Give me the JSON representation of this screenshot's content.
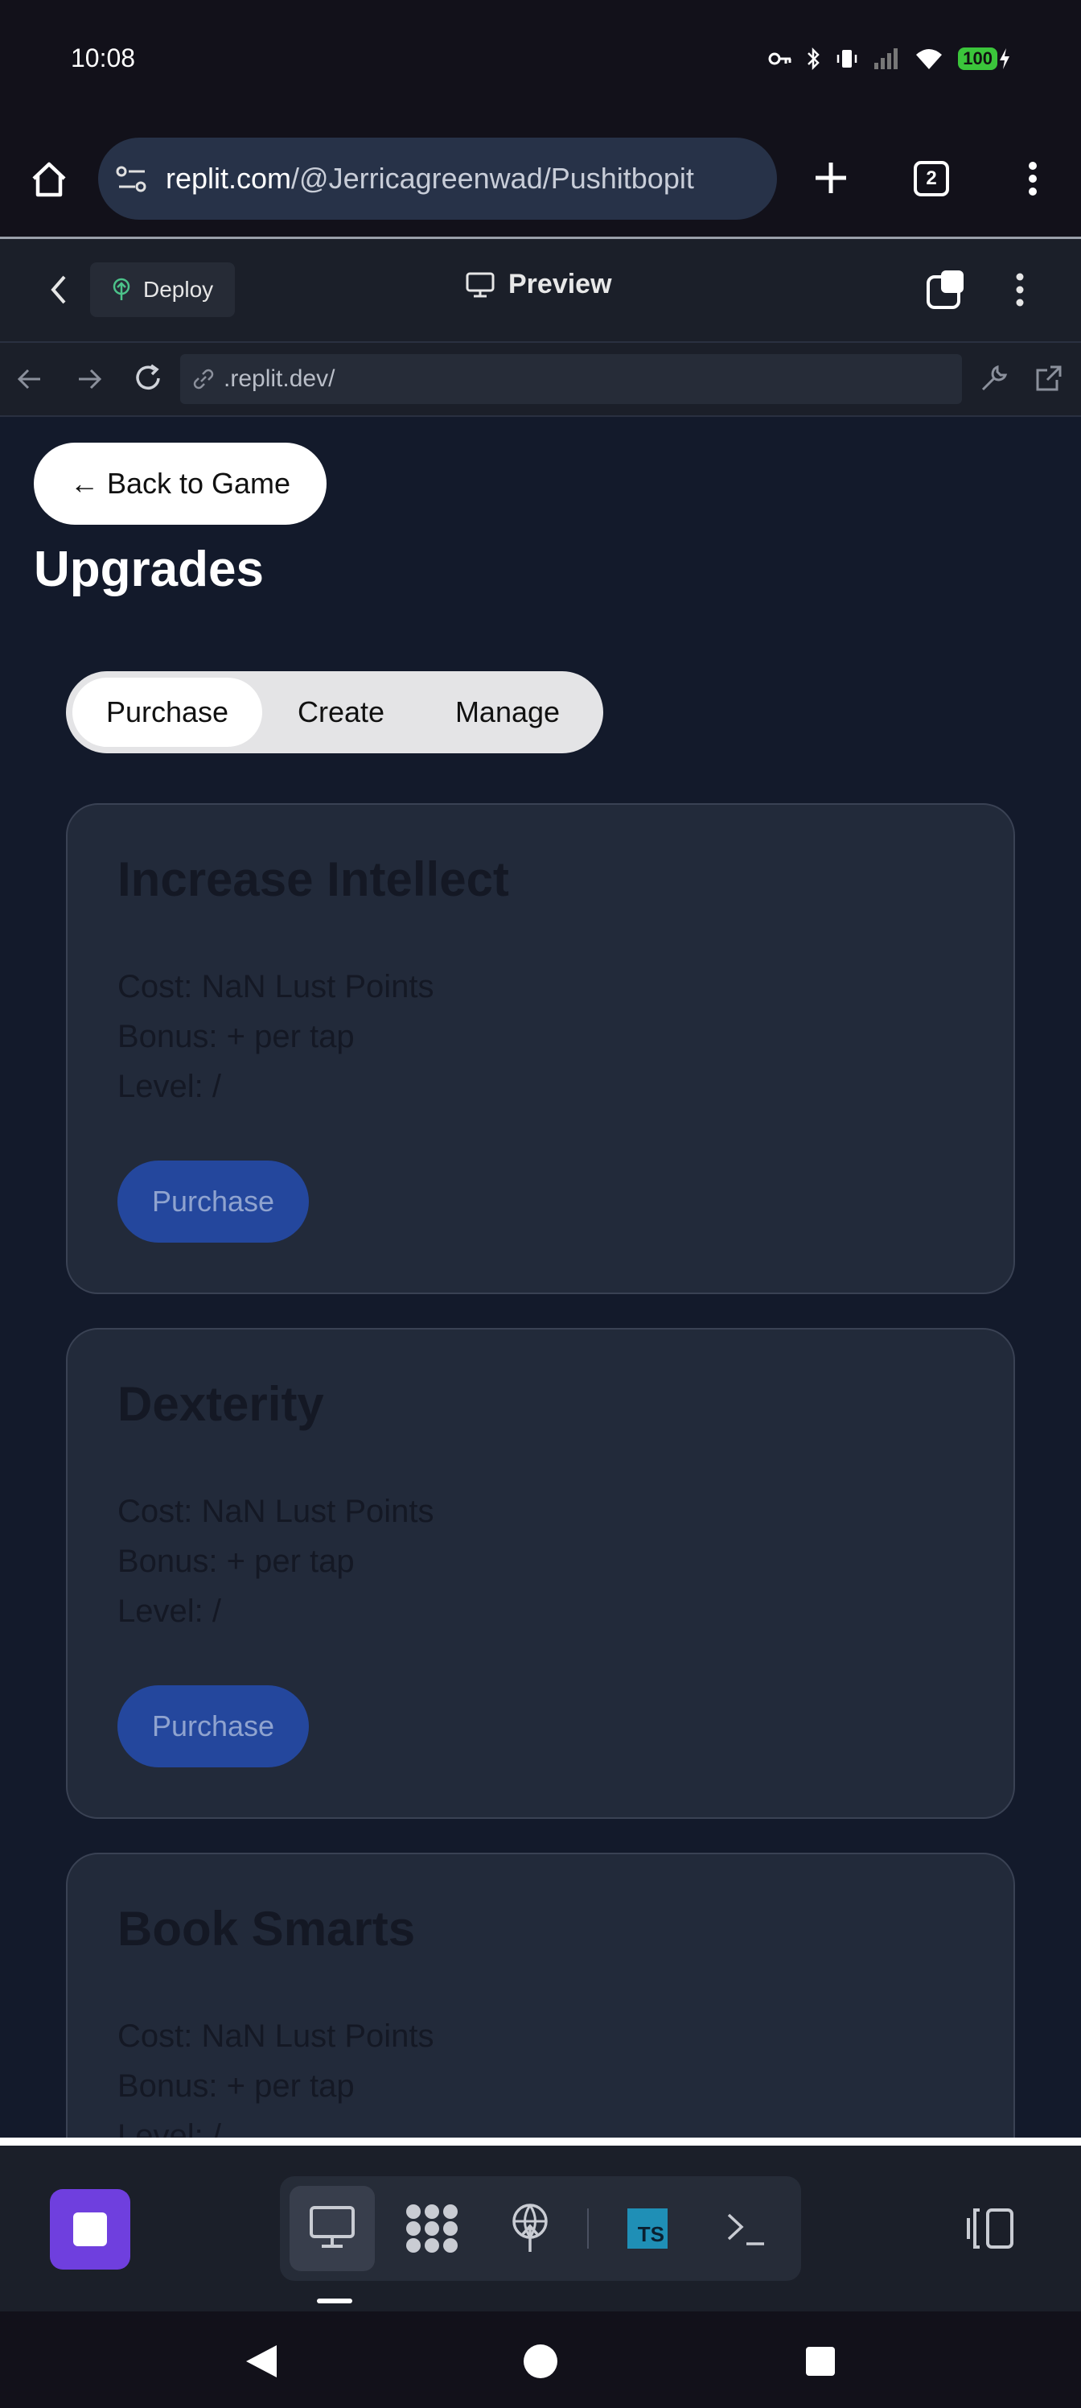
{
  "status_bar": {
    "time": "10:08",
    "battery": "100"
  },
  "browser": {
    "url_host": "replit.com",
    "url_path": "/@Jerricagreenwad/Pushitbopit",
    "tab_count": "2"
  },
  "replit_header": {
    "deploy_label": "Deploy",
    "preview_label": "Preview"
  },
  "nav": {
    "address": ".replit.dev/"
  },
  "page": {
    "back_label": "← Back to Game",
    "title": "Upgrades",
    "tabs": [
      {
        "label": "Purchase"
      },
      {
        "label": "Create"
      },
      {
        "label": "Manage"
      }
    ],
    "selected_tab": "Purchase",
    "cards": [
      {
        "title": "Increase Intellect",
        "cost": "Cost: NaN Lust Points",
        "bonus": "Bonus: + per tap",
        "level": "Level: /",
        "button": "Purchase"
      },
      {
        "title": "Dexterity",
        "cost": "Cost: NaN Lust Points",
        "bonus": "Bonus: + per tap",
        "level": "Level: /",
        "button": "Purchase"
      },
      {
        "title": "Book Smarts",
        "cost": "Cost: NaN Lust Points",
        "bonus": "Bonus: + per tap",
        "level": "Level: /"
      }
    ]
  },
  "dock": {
    "ts_label": "TS"
  },
  "colors": {
    "accent_purple": "#6f3fde",
    "button_blue": "#24479d",
    "battery_green": "#3bc53b",
    "background": "#131a2b"
  }
}
